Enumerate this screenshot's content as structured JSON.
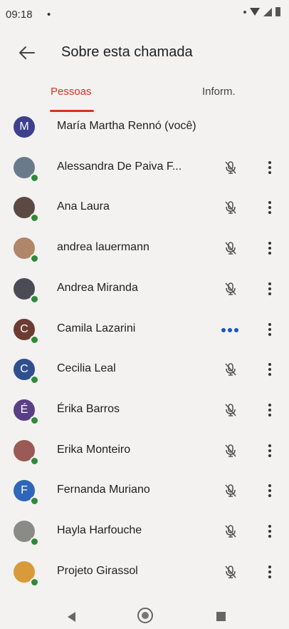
{
  "status": {
    "time": "09:18",
    "left_dot": "•"
  },
  "header": {
    "title": "Sobre esta chamada"
  },
  "tabs": [
    {
      "label": "Pessoas",
      "selected": true
    },
    {
      "label": "Inform.",
      "selected": false
    }
  ],
  "colors": {
    "accent": "#d93025",
    "presence": "#2e8b3a",
    "speaking": "#1a56c4"
  },
  "participants": [
    {
      "name": "María Martha Rennó (você)",
      "initial": "M",
      "avatar_color": "#3d3f8f",
      "state": "self"
    },
    {
      "name": "Alessandra De Paiva F...",
      "initial": "",
      "avatar_color": "#6b7a8a",
      "state": "muted"
    },
    {
      "name": "Ana Laura",
      "initial": "",
      "avatar_color": "#5b4a44",
      "state": "muted"
    },
    {
      "name": "andrea lauermann",
      "initial": "",
      "avatar_color": "#b0866a",
      "state": "muted"
    },
    {
      "name": "Andrea Miranda",
      "initial": "",
      "avatar_color": "#4a4b55",
      "state": "muted"
    },
    {
      "name": "Camila Lazarini",
      "initial": "C",
      "avatar_color": "#6e3b33",
      "state": "speaking"
    },
    {
      "name": "Cecilia Leal",
      "initial": "C",
      "avatar_color": "#2f4f8f",
      "state": "muted"
    },
    {
      "name": "Érika Barros",
      "initial": "É",
      "avatar_color": "#5b3f86",
      "state": "muted"
    },
    {
      "name": "Erika Monteiro",
      "initial": "",
      "avatar_color": "#9a5a55",
      "state": "muted"
    },
    {
      "name": "Fernanda Muriano",
      "initial": "F",
      "avatar_color": "#2e66b8",
      "state": "muted"
    },
    {
      "name": "Hayla Harfouche",
      "initial": "",
      "avatar_color": "#8a8a86",
      "state": "muted"
    },
    {
      "name": "Projeto Girassol",
      "initial": "",
      "avatar_color": "#d99a3a",
      "state": "muted"
    }
  ]
}
